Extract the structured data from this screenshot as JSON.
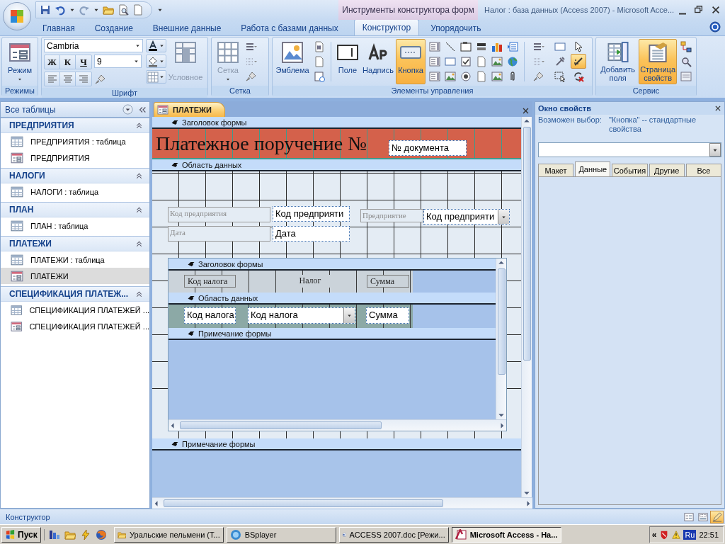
{
  "window": {
    "tool_group": "Инструменты конструктора форм",
    "title": "Налог : база данных (Access 2007) - Microsoft Acce..."
  },
  "ribbon_tabs": [
    {
      "label": "Главная",
      "selected": false
    },
    {
      "label": "Создание",
      "selected": false
    },
    {
      "label": "Внешние данные",
      "selected": false
    },
    {
      "label": "Работа с базами данных",
      "selected": false
    },
    {
      "label": "Конструктор",
      "selected": true
    },
    {
      "label": "Упорядочить",
      "selected": false
    }
  ],
  "ribbon": {
    "views": {
      "title": "Режимы",
      "button": "Режим"
    },
    "font": {
      "title": "Шрифт",
      "font_name": "Cambria",
      "font_size": "9",
      "bold": "Ж",
      "italic": "К",
      "underline": "Ч",
      "conditional": {
        "label": "Условное",
        "disabled": true
      }
    },
    "grid": {
      "title": "Сетка",
      "button": {
        "label": "Сетка",
        "disabled": true
      }
    },
    "controls": {
      "title": "Элементы управления",
      "buttons": [
        {
          "label": "Эмблема",
          "selected": false
        },
        {
          "label": "Поле",
          "selected": false
        },
        {
          "label": "Надпись",
          "selected": false
        },
        {
          "label": "Кнопка",
          "selected": true
        }
      ],
      "wizards_selected": true
    },
    "tools": {
      "title": "Сервис",
      "buttons": [
        {
          "label": "Добавить поля",
          "selected": false
        },
        {
          "label": "Страница свойств",
          "selected": true
        }
      ]
    }
  },
  "navigation": {
    "title": "Все таблицы",
    "groups": [
      {
        "title": "ПРЕДПРИЯТИЯ",
        "expanded": true,
        "items": [
          {
            "kind": "table",
            "label": "ПРЕДПРИЯТИЯ : таблица",
            "selected": false
          },
          {
            "kind": "form",
            "label": "ПРЕДПРИЯТИЯ",
            "selected": false
          }
        ]
      },
      {
        "title": "НАЛОГИ",
        "expanded": true,
        "items": [
          {
            "kind": "table",
            "label": "НАЛОГИ : таблица",
            "selected": false
          }
        ]
      },
      {
        "title": "ПЛАН",
        "expanded": true,
        "items": [
          {
            "kind": "table",
            "label": "ПЛАН : таблица",
            "selected": false
          }
        ]
      },
      {
        "title": "ПЛАТЕЖИ",
        "expanded": true,
        "items": [
          {
            "kind": "table",
            "label": "ПЛАТЕЖИ : таблица",
            "selected": false
          },
          {
            "kind": "form",
            "label": "ПЛАТЕЖИ",
            "selected": true
          }
        ]
      },
      {
        "title": "СПЕЦИФИКАЦИЯ ПЛАТЕЖ...",
        "expanded": true,
        "items": [
          {
            "kind": "table",
            "label": "СПЕЦИФИКАЦИЯ ПЛАТЕЖЕЙ ...",
            "selected": false
          },
          {
            "kind": "form",
            "label": "СПЕЦИФИКАЦИЯ ПЛАТЕЖЕЙ ...",
            "selected": false
          }
        ]
      }
    ]
  },
  "document": {
    "tab": "ПЛАТЕЖИ",
    "form_header": {
      "bar": "Заголовок формы",
      "title": "Платежное поручение №",
      "field": "№ документа"
    },
    "detail": {
      "bar": "Область данных",
      "controls": [
        {
          "kind": "label",
          "text": "Код предприятия"
        },
        {
          "kind": "label",
          "text": "Дата"
        },
        {
          "kind": "textbox",
          "text": "Код предприяти"
        },
        {
          "kind": "textbox",
          "text": "Дата"
        },
        {
          "kind": "label",
          "text": "Предприятие"
        },
        {
          "kind": "combobox",
          "text": "Код предприяти"
        }
      ]
    },
    "subform": {
      "header_bar": "Заголовок формы",
      "header_controls": [
        {
          "kind": "label",
          "text": "Код налога"
        },
        {
          "kind": "caption",
          "text": "Налог"
        },
        {
          "kind": "label",
          "text": "Сумма"
        }
      ],
      "detail_bar": "Область данных",
      "detail_controls": [
        {
          "kind": "textbox",
          "text": "Код налога"
        },
        {
          "kind": "combobox",
          "text": "Код налога"
        },
        {
          "kind": "textbox",
          "text": "Сумма"
        }
      ],
      "footer_bar": "Примечание формы"
    },
    "form_footer": {
      "bar": "Примечание формы"
    }
  },
  "property_sheet": {
    "title": "Окно свойств",
    "selection_label": "Возможен выбор:",
    "selection_value": "\"Кнопка\" -- стандартные свойства",
    "tabs": [
      {
        "label": "Макет",
        "selected": false
      },
      {
        "label": "Данные",
        "selected": true
      },
      {
        "label": "События",
        "selected": false
      },
      {
        "label": "Другие",
        "selected": false
      },
      {
        "label": "Все",
        "selected": false
      }
    ]
  },
  "status_bar": {
    "text": "Конструктор",
    "view_buttons": [
      {
        "kind": "form",
        "selected": false
      },
      {
        "kind": "layout",
        "selected": false
      },
      {
        "kind": "design",
        "selected": true
      }
    ]
  },
  "taskbar": {
    "start": "Пуск",
    "tasks": [
      {
        "kind": "folder",
        "label": "Уральские пельмени (Т...",
        "selected": false
      },
      {
        "kind": "player",
        "label": "BSplayer",
        "selected": false
      },
      {
        "kind": "word",
        "label": "ACCESS 2007.doc [Режи...",
        "selected": false
      },
      {
        "kind": "access",
        "label": "Microsoft Access - На...",
        "selected": true
      }
    ],
    "tray_toggle": "«",
    "language": "Ru",
    "clock": "22:51"
  }
}
